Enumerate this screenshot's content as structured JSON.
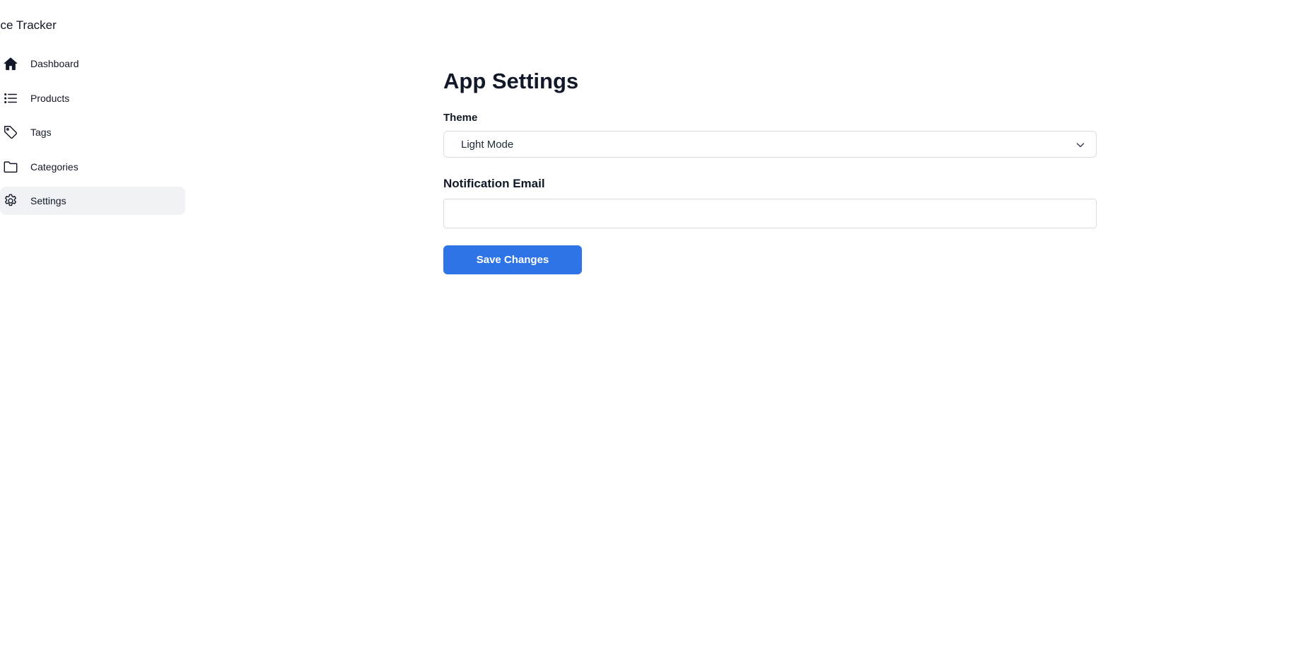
{
  "app": {
    "title": "rice Tracker"
  },
  "sidebar": {
    "items": [
      {
        "label": "Dashboard",
        "icon": "home-icon"
      },
      {
        "label": "Products",
        "icon": "list-icon"
      },
      {
        "label": "Tags",
        "icon": "tag-icon"
      },
      {
        "label": "Categories",
        "icon": "folder-icon"
      },
      {
        "label": "Settings",
        "icon": "gear-icon",
        "active": true
      }
    ]
  },
  "main": {
    "title": "App Settings",
    "theme": {
      "label": "Theme",
      "value": "Light Mode"
    },
    "email": {
      "label": "Notification Email",
      "value": "",
      "placeholder": ""
    },
    "save_label": "Save Changes"
  },
  "colors": {
    "accent": "#2f74e6",
    "active_bg": "#f1f2f5",
    "border": "#d9dbe0",
    "text": "#111827"
  }
}
